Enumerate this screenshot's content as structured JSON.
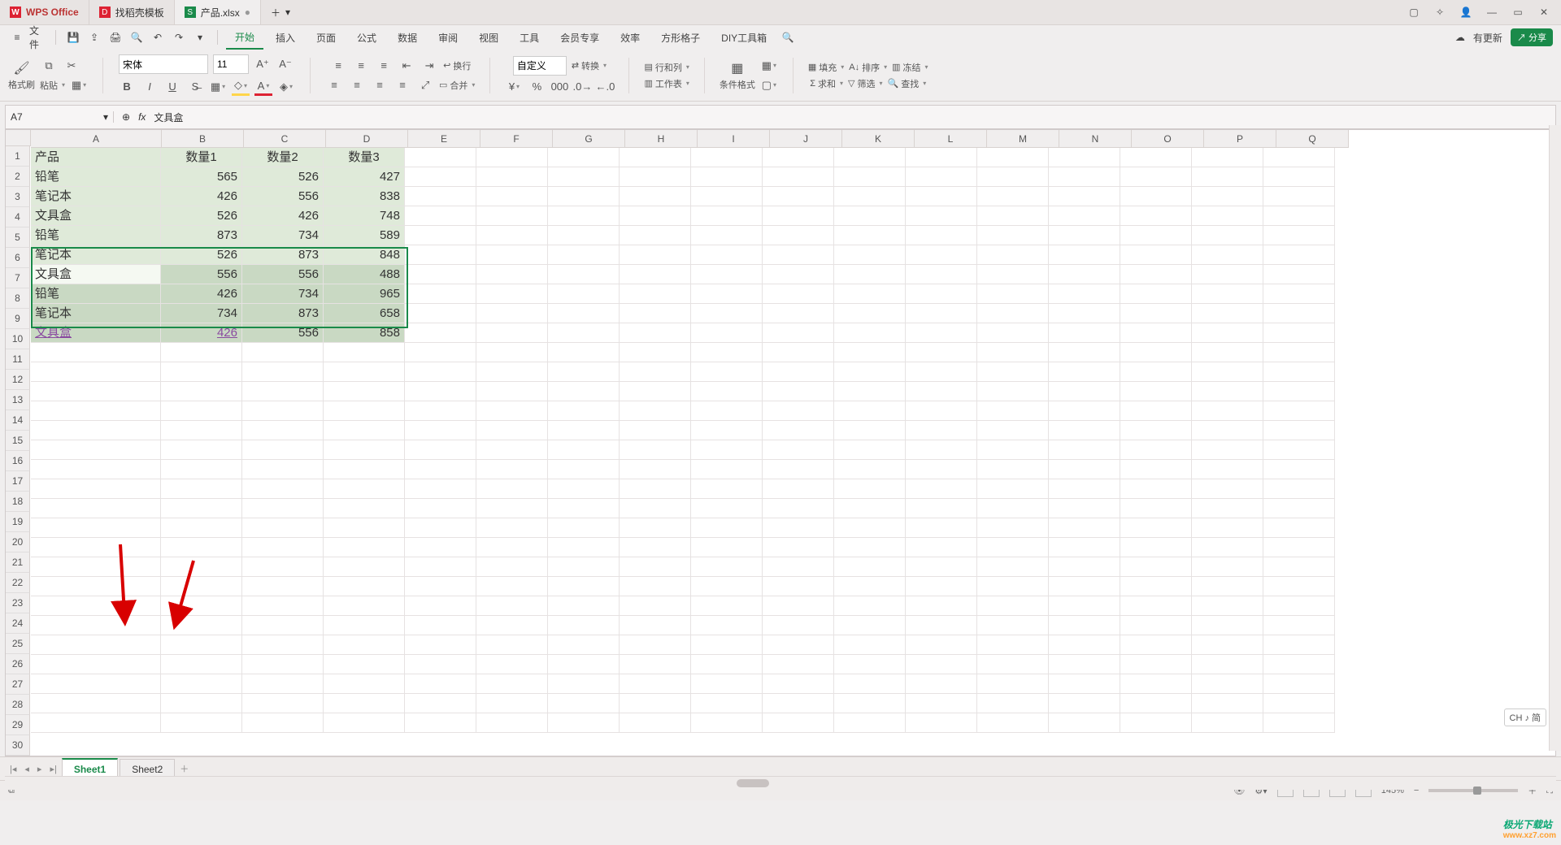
{
  "tabs": {
    "app": "WPS Office",
    "template": "找稻壳模板",
    "file": "产品.xlsx",
    "dirty": "●"
  },
  "menu": {
    "file": "文件",
    "items": [
      "开始",
      "插入",
      "页面",
      "公式",
      "数据",
      "审阅",
      "视图",
      "工具",
      "会员专享",
      "效率",
      "方形格子",
      "DIY工具箱"
    ],
    "update": "有更新",
    "share": "分享"
  },
  "ribbon": {
    "format_painter": "格式刷",
    "paste": "粘贴",
    "font_name": "宋体",
    "font_size": "11",
    "wrap": "换行",
    "merge": "合并",
    "number_format": "自定义",
    "convert": "转换",
    "rowcol": "行和列",
    "worksheet": "工作表",
    "cond_format": "条件格式",
    "fill": "填充",
    "sort": "排序",
    "freeze": "冻结",
    "sum": "求和",
    "filter": "筛选",
    "find": "查找"
  },
  "namebox": "A7",
  "formula": "文具盒",
  "columns": [
    "A",
    "B",
    "C",
    "D",
    "E",
    "F",
    "G",
    "H",
    "I",
    "J",
    "K",
    "L",
    "M",
    "N",
    "O",
    "P",
    "Q"
  ],
  "row_count": 30,
  "table": {
    "headers": [
      "产品",
      "数量1",
      "数量2",
      "数量3"
    ],
    "rows": [
      [
        "铅笔",
        "565",
        "526",
        "427"
      ],
      [
        "笔记本",
        "426",
        "556",
        "838"
      ],
      [
        "文具盒",
        "526",
        "426",
        "748"
      ],
      [
        "铅笔",
        "873",
        "734",
        "589"
      ],
      [
        "笔记本",
        "526",
        "873",
        "848"
      ],
      [
        "文具盒",
        "556",
        "556",
        "488"
      ],
      [
        "铅笔",
        "426",
        "734",
        "965"
      ],
      [
        "笔记本",
        "734",
        "873",
        "658"
      ],
      [
        "文具盒",
        "426",
        "556",
        "858"
      ]
    ]
  },
  "sheets": [
    "Sheet1",
    "Sheet2"
  ],
  "status": {
    "zoom": "145%",
    "ime": "CH ♪ 简"
  },
  "watermark": {
    "brand": "极光下载站",
    "url": "www.xz7.com"
  }
}
